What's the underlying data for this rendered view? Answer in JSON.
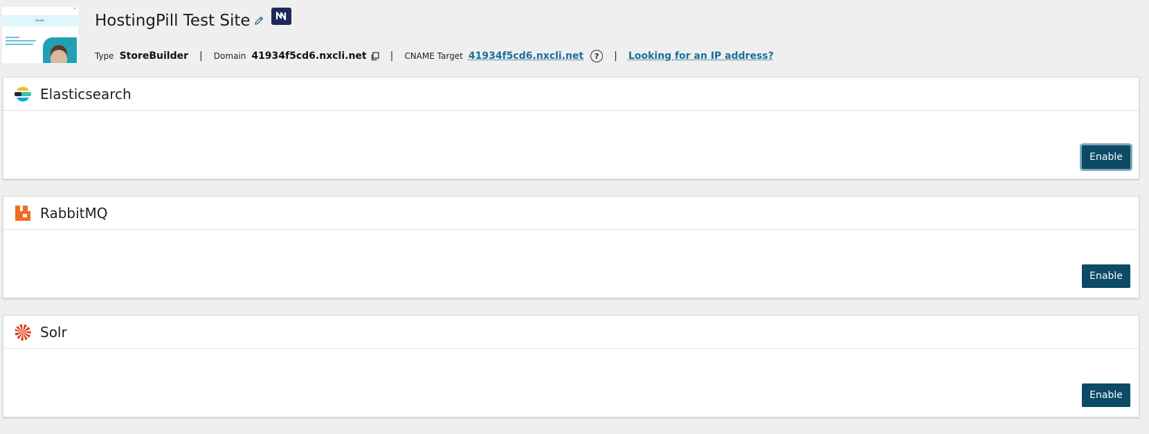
{
  "site": {
    "title": "HostingPill Test Site",
    "thumbnail_label": "Router",
    "type_label": "Type",
    "type_value": "StoreBuilder",
    "domain_label": "Domain",
    "domain_value": "41934f5cd6.nxcli.net",
    "cname_label": "CNAME Target",
    "cname_value": "41934f5cd6.nxcli.net",
    "ip_link": "Looking for an IP address?",
    "separator": "|",
    "help_symbol": "?"
  },
  "services": [
    {
      "name": "Elasticsearch",
      "icon": "elasticsearch-icon",
      "button": "Enable"
    },
    {
      "name": "RabbitMQ",
      "icon": "rabbitmq-icon",
      "button": "Enable"
    },
    {
      "name": "Solr",
      "icon": "solr-icon",
      "button": "Enable"
    }
  ],
  "colors": {
    "background": "#efefef",
    "button": "#0c4a66",
    "link": "#1a6f98",
    "badge": "#1b2a5a"
  }
}
